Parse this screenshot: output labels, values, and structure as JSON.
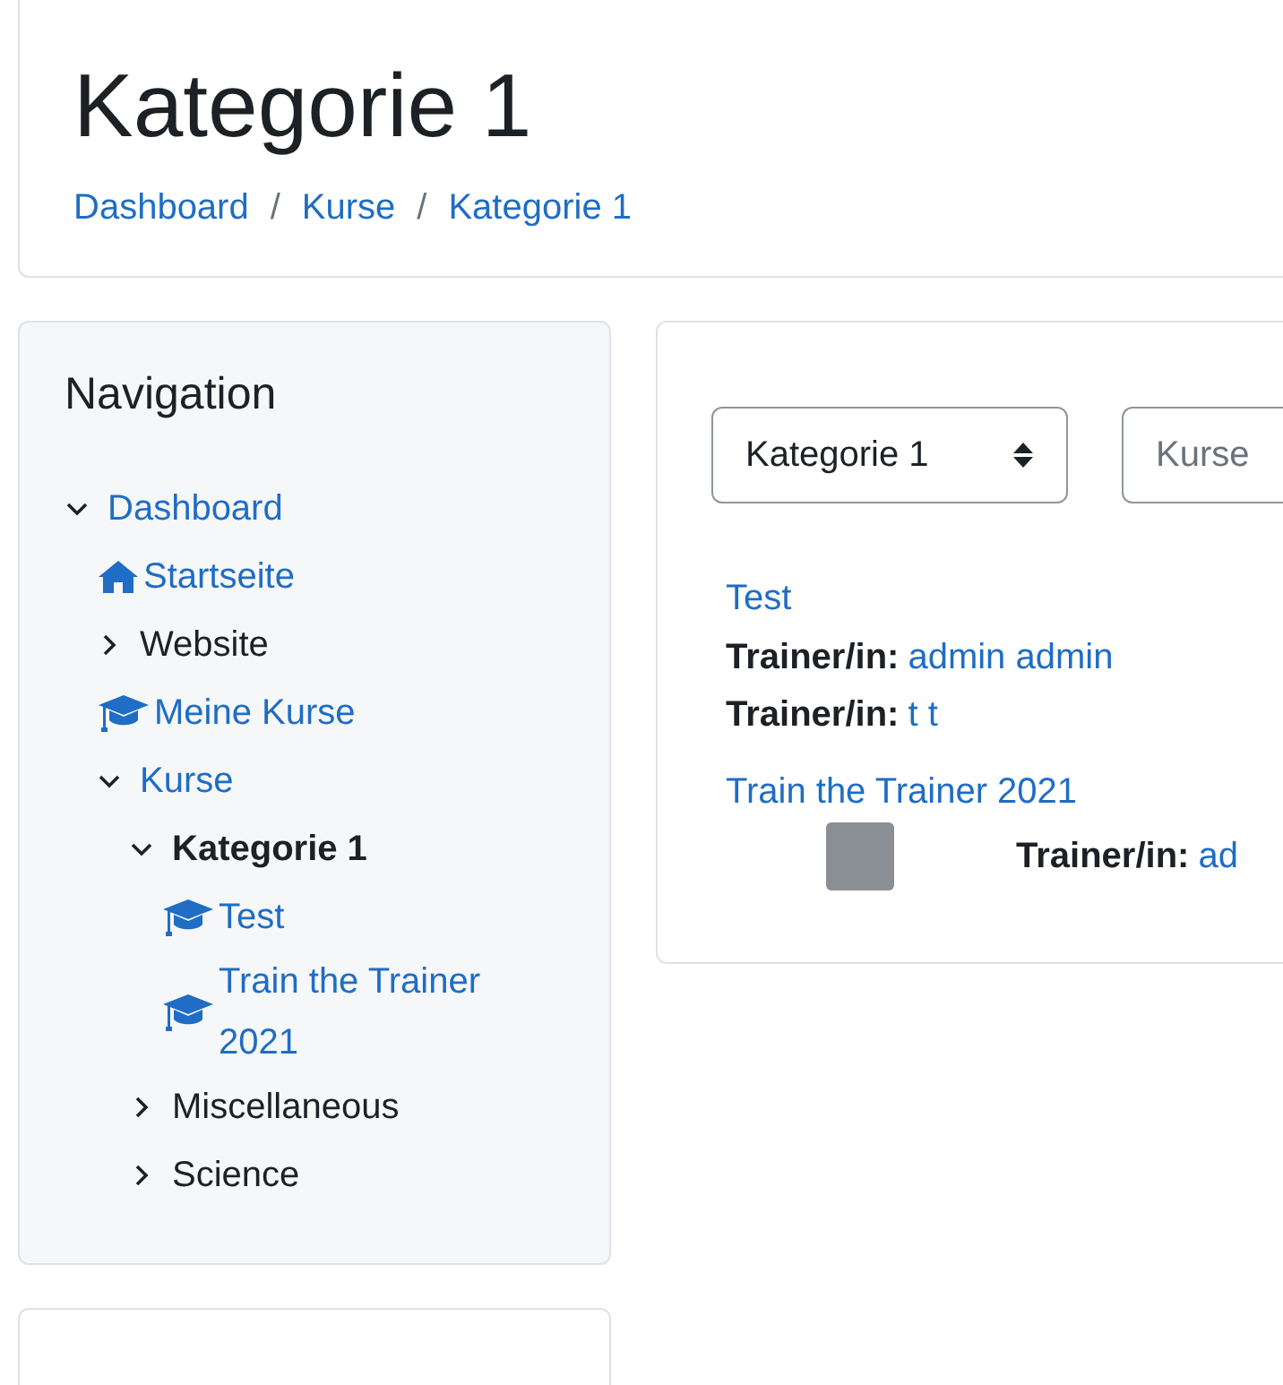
{
  "header": {
    "title": "Kategorie 1",
    "breadcrumb": [
      {
        "kind": "link",
        "text": "Dashboard"
      },
      {
        "kind": "separator",
        "text": "/"
      },
      {
        "kind": "link",
        "text": "Kurse"
      },
      {
        "kind": "separator",
        "text": "/"
      },
      {
        "kind": "link",
        "text": "Kategorie 1"
      }
    ]
  },
  "navigation": {
    "title": "Navigation",
    "items": [
      {
        "label": "Dashboard",
        "kind": "branch",
        "expanded": true,
        "link": true,
        "current": false,
        "children": [
          {
            "label": "Startseite",
            "kind": "home",
            "link": true,
            "current": false
          },
          {
            "label": "Website",
            "kind": "branch",
            "expanded": false,
            "link": false,
            "current": false
          },
          {
            "label": "Meine Kurse",
            "kind": "course",
            "link": true,
            "current": false
          },
          {
            "label": "Kurse",
            "kind": "branch",
            "expanded": true,
            "link": true,
            "current": false,
            "children": [
              {
                "label": "Kategorie 1",
                "kind": "branch",
                "expanded": true,
                "link": false,
                "current": true,
                "children": [
                  {
                    "label": "Test",
                    "kind": "course",
                    "link": true,
                    "current": false
                  },
                  {
                    "label": "Train the Trainer 2021",
                    "kind": "course",
                    "link": true,
                    "current": false
                  }
                ]
              },
              {
                "label": "Miscellaneous",
                "kind": "branch",
                "expanded": false,
                "link": false,
                "current": false
              },
              {
                "label": "Science",
                "kind": "branch",
                "expanded": false,
                "link": false,
                "current": false
              }
            ]
          }
        ]
      }
    ]
  },
  "main": {
    "category_select": {
      "value": "Kategorie 1"
    },
    "search": {
      "placeholder": "Kurse"
    },
    "courses": [
      {
        "name": "Test",
        "has_image": false,
        "teachers": [
          {
            "role": "Trainer/in:",
            "name": "admin admin"
          },
          {
            "role": "Trainer/in:",
            "name": "t t"
          }
        ]
      },
      {
        "name": "Train the Trainer 2021",
        "has_image": true,
        "teachers": [
          {
            "role": "Trainer/in:",
            "name": "ad"
          }
        ]
      }
    ]
  }
}
